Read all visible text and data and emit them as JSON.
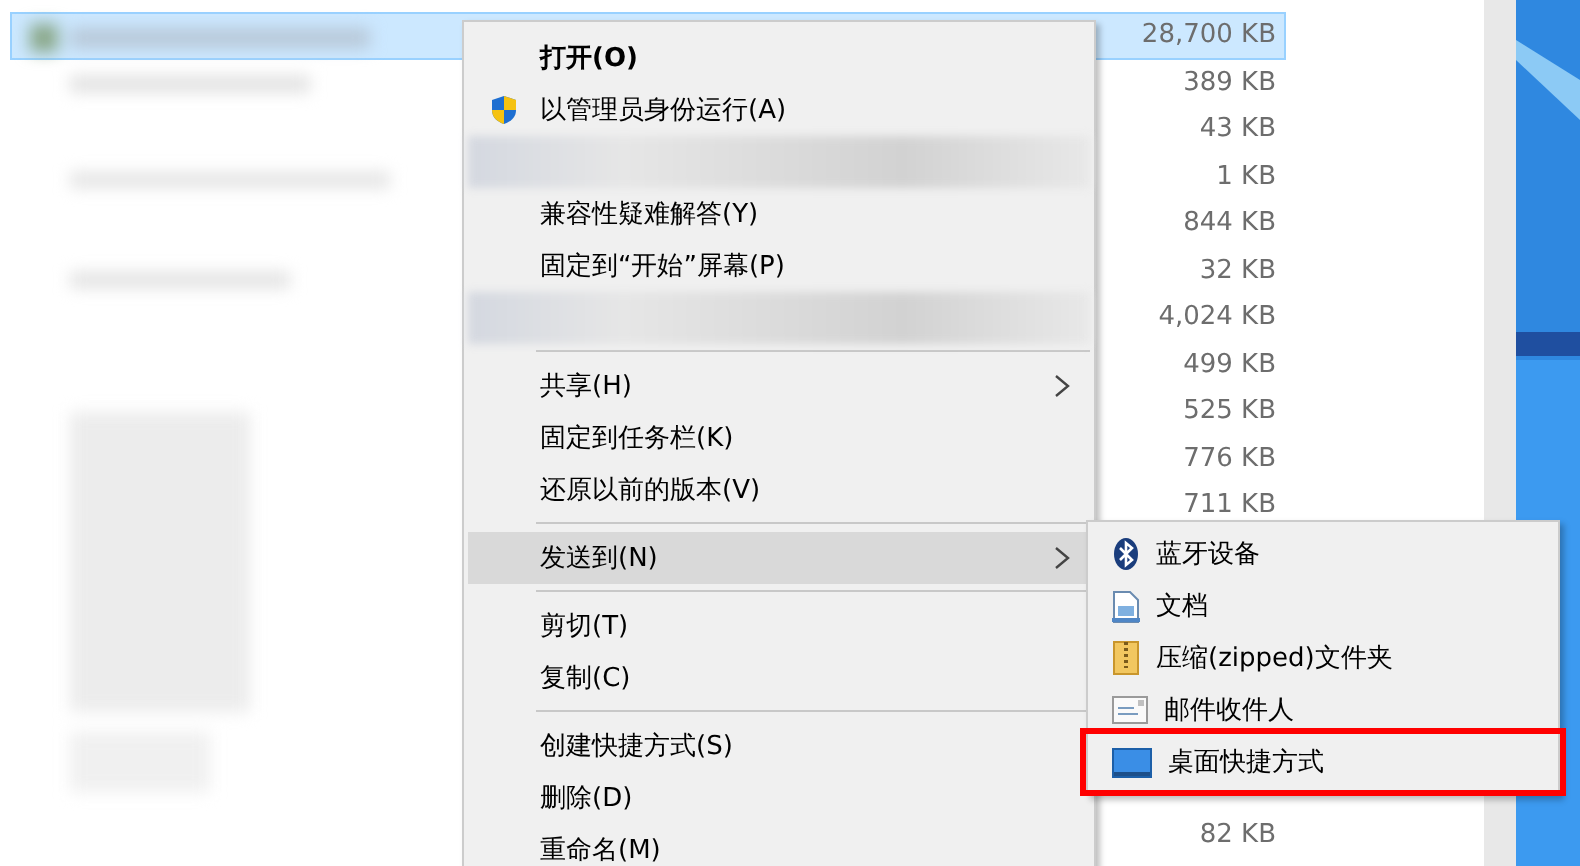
{
  "file_list": {
    "rows": [
      {
        "size": "28,700 KB",
        "selected": true
      },
      {
        "size": "389 KB",
        "selected": false
      },
      {
        "size": "43 KB",
        "selected": false
      },
      {
        "size": "1 KB",
        "selected": false
      },
      {
        "size": "844 KB",
        "selected": false
      },
      {
        "size": "32 KB",
        "selected": false
      },
      {
        "size": "4,024 KB",
        "selected": false
      },
      {
        "size": "499 KB",
        "selected": false
      },
      {
        "size": "525 KB",
        "selected": false
      },
      {
        "size": "776 KB",
        "selected": false
      },
      {
        "size": "711 KB",
        "selected": false
      }
    ],
    "rows_below_submenu": [
      {
        "size": "82 KB",
        "selected": false
      }
    ]
  },
  "context_menu": {
    "items": [
      {
        "kind": "item",
        "label": "打开(O)",
        "default": true,
        "submenu": false,
        "selected": false
      },
      {
        "kind": "shield_item",
        "label": "以管理员身份运行(A)",
        "default": false,
        "submenu": false,
        "selected": false
      },
      {
        "kind": "redacted"
      },
      {
        "kind": "item",
        "label": "兼容性疑难解答(Y)",
        "default": false,
        "submenu": false,
        "selected": false
      },
      {
        "kind": "item",
        "label": "固定到“开始”屏幕(P)",
        "default": false,
        "submenu": false,
        "selected": false
      },
      {
        "kind": "redacted"
      },
      {
        "kind": "separator"
      },
      {
        "kind": "item",
        "label": "共享(H)",
        "default": false,
        "submenu": true,
        "selected": false
      },
      {
        "kind": "item",
        "label": "固定到任务栏(K)",
        "default": false,
        "submenu": false,
        "selected": false
      },
      {
        "kind": "item",
        "label": "还原以前的版本(V)",
        "default": false,
        "submenu": false,
        "selected": false
      },
      {
        "kind": "separator"
      },
      {
        "kind": "item",
        "label": "发送到(N)",
        "default": false,
        "submenu": true,
        "selected": true
      },
      {
        "kind": "separator"
      },
      {
        "kind": "item",
        "label": "剪切(T)",
        "default": false,
        "submenu": false,
        "selected": false
      },
      {
        "kind": "item",
        "label": "复制(C)",
        "default": false,
        "submenu": false,
        "selected": false
      },
      {
        "kind": "separator"
      },
      {
        "kind": "item",
        "label": "创建快捷方式(S)",
        "default": false,
        "submenu": false,
        "selected": false
      },
      {
        "kind": "item",
        "label": "删除(D)",
        "default": false,
        "submenu": false,
        "selected": false
      },
      {
        "kind": "item",
        "label": "重命名(M)",
        "default": false,
        "submenu": false,
        "selected": false
      }
    ]
  },
  "send_to_menu": {
    "items": [
      {
        "label": "蓝牙设备",
        "kind": "bluetooth",
        "highlighted": false
      },
      {
        "label": "文档",
        "kind": "document",
        "highlighted": false
      },
      {
        "label": "压缩(zipped)文件夹",
        "kind": "zip",
        "highlighted": false
      },
      {
        "label": "邮件收件人",
        "kind": "mail",
        "highlighted": false
      },
      {
        "label": "桌面快捷方式",
        "kind": "desktop",
        "highlighted": true
      }
    ]
  }
}
